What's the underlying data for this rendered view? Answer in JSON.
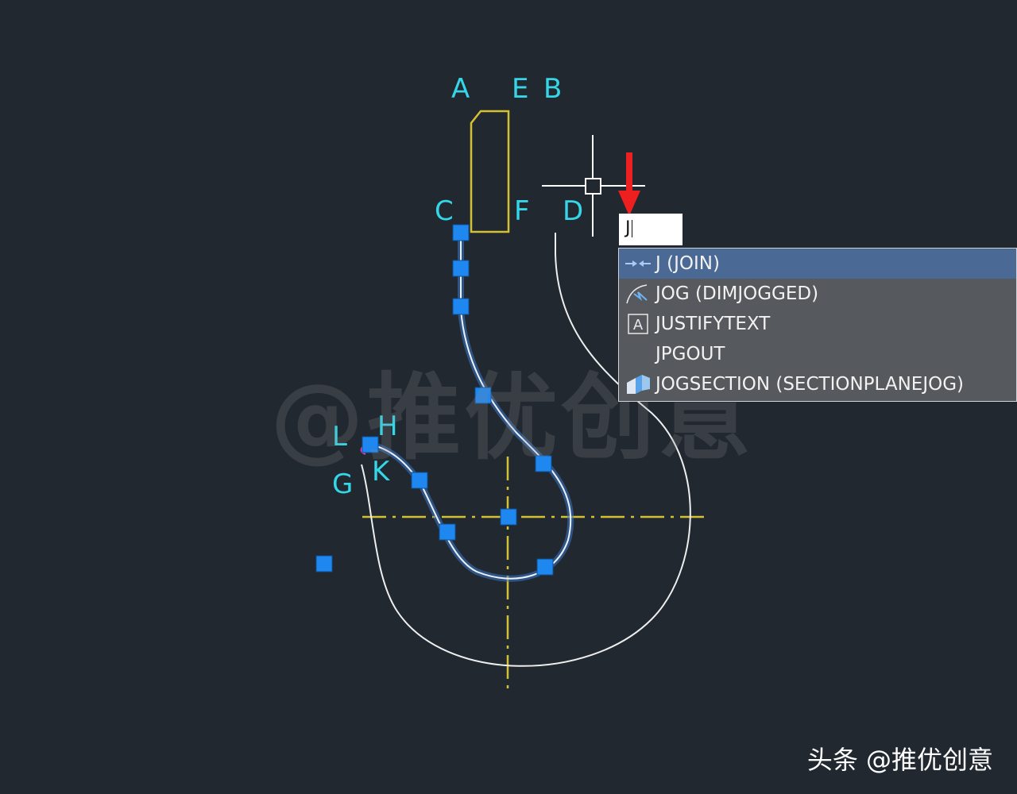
{
  "points": {
    "A": "A",
    "E": "E",
    "B": "B",
    "C": "C",
    "F": "F",
    "D": "D",
    "H": "H",
    "L": "L",
    "K": "K",
    "G": "G"
  },
  "command_input": {
    "value": "J"
  },
  "autocomplete": {
    "items": [
      {
        "label": "J (JOIN)",
        "icon": "join-icon",
        "selected": true
      },
      {
        "label": "JOG (DIMJOGGED)",
        "icon": "jog-dimension-icon",
        "selected": false
      },
      {
        "label": "JUSTIFYTEXT",
        "icon": "justify-text-icon",
        "selected": false
      },
      {
        "label": "JPGOUT",
        "icon": "",
        "selected": false
      },
      {
        "label": "JOGSECTION (SECTIONPLANEJOG)",
        "icon": "section-plane-icon",
        "selected": false
      }
    ]
  },
  "watermark": "@推优创意",
  "footer": "头条 @推优创意",
  "colors": {
    "background": "#212830",
    "label": "#35d6e8",
    "outline": "#d4c034",
    "centerline": "#d4c034",
    "grip": "#1e88f0",
    "selection_highlight": "#4a6995",
    "arrow": "#ee1f1f"
  }
}
